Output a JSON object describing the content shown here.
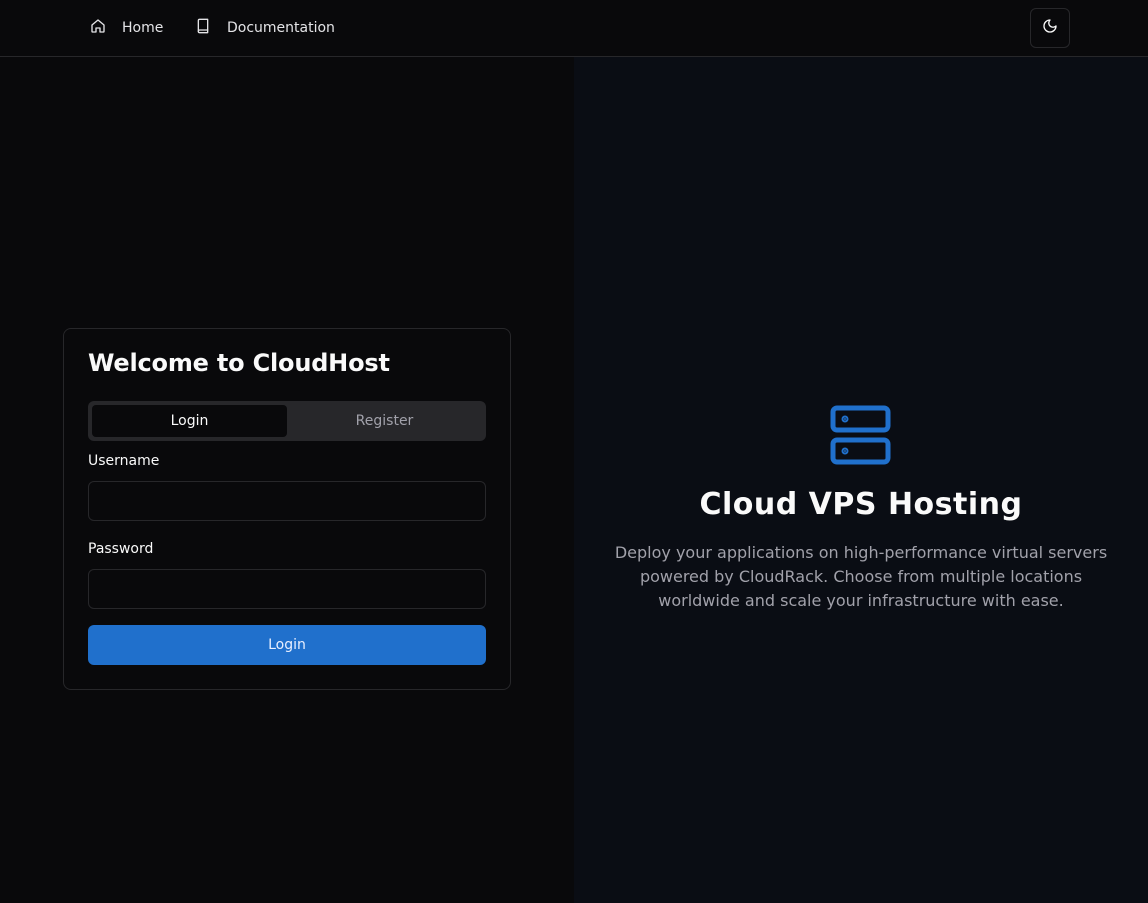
{
  "nav": {
    "home_label": "Home",
    "docs_label": "Documentation"
  },
  "card": {
    "title": "Welcome to CloudHost",
    "tabs": [
      {
        "label": "Login",
        "active": true
      },
      {
        "label": "Register",
        "active": false
      }
    ],
    "username_label": "Username",
    "username_value": "",
    "password_label": "Password",
    "password_value": "",
    "submit_label": "Login"
  },
  "hero": {
    "title": "Cloud VPS Hosting",
    "description": "Deploy your applications on high-performance virtual servers powered by CloudRack. Choose from multiple locations worldwide and scale your infrastructure with ease."
  },
  "icons": {
    "home": "home-icon",
    "docs": "book-icon",
    "theme": "moon-icon",
    "hero": "server-icon"
  },
  "colors": {
    "accent": "#2070cc",
    "background": "#09090b",
    "panel": "#0a0d14",
    "border": "#27272a"
  }
}
